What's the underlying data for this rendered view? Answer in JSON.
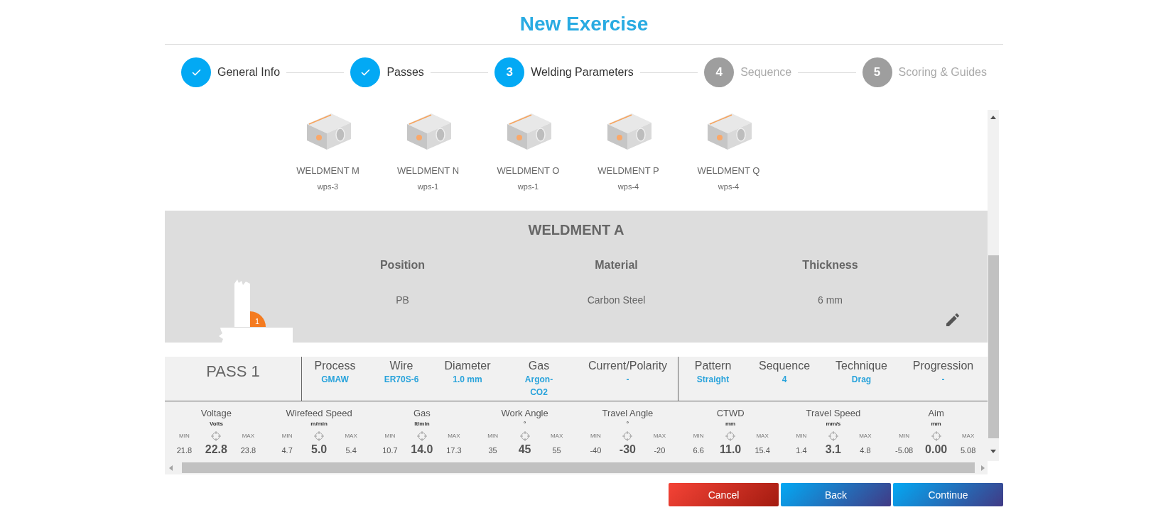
{
  "title": "New Exercise",
  "steps": [
    {
      "label": "General Info",
      "kind": "completed"
    },
    {
      "label": "Passes",
      "kind": "completed"
    },
    {
      "number": "3",
      "label": "Welding Parameters",
      "kind": "current"
    },
    {
      "number": "4",
      "label": "Sequence",
      "kind": "upcoming"
    },
    {
      "number": "5",
      "label": "Scoring & Guides",
      "kind": "upcoming"
    }
  ],
  "weldments": [
    {
      "name": "WELDMENT M",
      "wps": "wps-3"
    },
    {
      "name": "WELDMENT N",
      "wps": "wps-1"
    },
    {
      "name": "WELDMENT O",
      "wps": "wps-1"
    },
    {
      "name": "WELDMENT P",
      "wps": "wps-4"
    },
    {
      "name": "WELDMENT Q",
      "wps": "wps-4"
    }
  ],
  "weldment_detail": {
    "title": "WELDMENT A",
    "pass_number": "1",
    "fields": [
      {
        "label": "Position",
        "value": "PB"
      },
      {
        "label": "Material",
        "value": "Carbon Steel"
      },
      {
        "label": "Thickness",
        "value": "6 mm"
      }
    ]
  },
  "pass": {
    "title": "PASS 1",
    "groups": [
      {
        "fields": [
          {
            "label": "Process",
            "value": "GMAW"
          },
          {
            "label": "Wire",
            "value": "ER70S-6"
          },
          {
            "label": "Diameter",
            "value": "1.0 mm"
          },
          {
            "label": "Gas",
            "value": "Argon-CO2"
          },
          {
            "label": "Current/Polarity",
            "value": "-"
          }
        ]
      },
      {
        "fields": [
          {
            "label": "Pattern",
            "value": "Straight"
          },
          {
            "label": "Sequence",
            "value": "4"
          },
          {
            "label": "Technique",
            "value": "Drag"
          },
          {
            "label": "Progression",
            "value": "-"
          }
        ]
      }
    ],
    "parameters": [
      {
        "name": "Voltage",
        "unit": "Volts",
        "min_label": "MIN",
        "max_label": "MAX",
        "min": "21.8",
        "value": "22.8",
        "max": "23.8"
      },
      {
        "name": "Wirefeed Speed",
        "unit": "m/min",
        "min_label": "MIN",
        "max_label": "MAX",
        "min": "4.7",
        "value": "5.0",
        "max": "5.4"
      },
      {
        "name": "Gas",
        "unit": "lt/min",
        "min_label": "MIN",
        "max_label": "MAX",
        "min": "10.7",
        "value": "14.0",
        "max": "17.3"
      },
      {
        "name": "Work Angle",
        "unit": "°",
        "min_label": "MIN",
        "max_label": "MAX",
        "min": "35",
        "value": "45",
        "max": "55"
      },
      {
        "name": "Travel Angle",
        "unit": "°",
        "min_label": "MIN",
        "max_label": "MAX",
        "min": "-40",
        "value": "-30",
        "max": "-20"
      },
      {
        "name": "CTWD",
        "unit": "mm",
        "min_label": "MIN",
        "max_label": "MAX",
        "min": "6.6",
        "value": "11.0",
        "max": "15.4"
      },
      {
        "name": "Travel Speed",
        "unit": "mm/s",
        "min_label": "MIN",
        "max_label": "MAX",
        "min": "1.4",
        "value": "3.1",
        "max": "4.8"
      },
      {
        "name": "Aim",
        "unit": "mm",
        "min_label": "MIN",
        "max_label": "MAX",
        "min": "-5.08",
        "value": "0.00",
        "max": "5.08"
      }
    ]
  },
  "buttons": [
    {
      "label": "Cancel",
      "kind": "cancel"
    },
    {
      "label": "Back",
      "kind": "primary"
    },
    {
      "label": "Continue",
      "kind": "primary"
    }
  ]
}
